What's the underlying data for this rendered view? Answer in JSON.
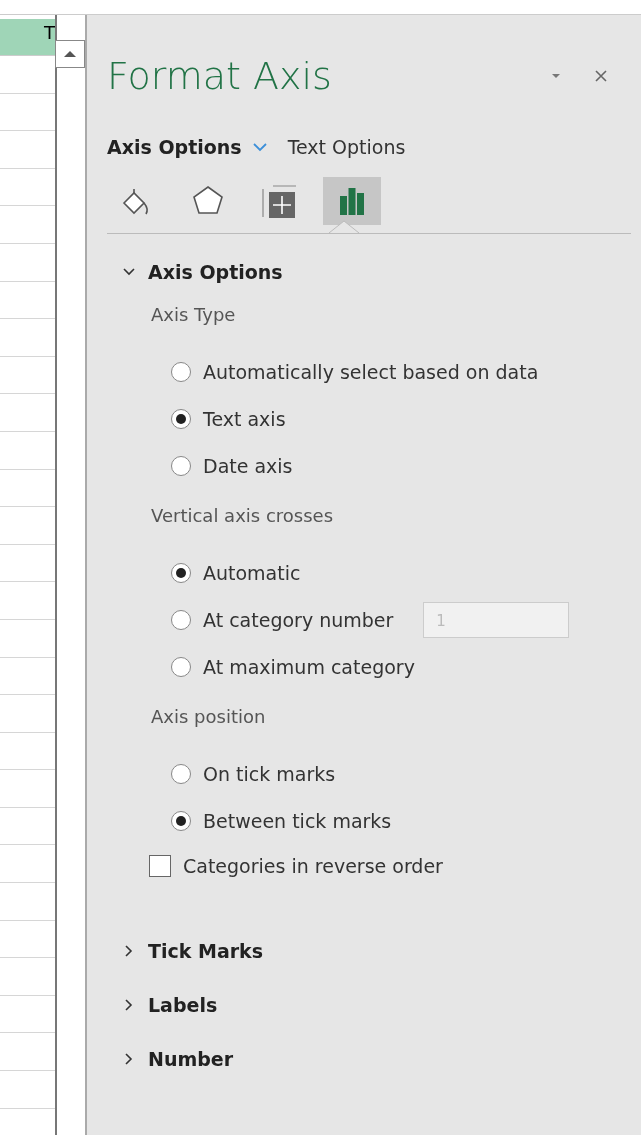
{
  "sheet": {
    "header_cell": "T"
  },
  "panel": {
    "title": "Format Axis",
    "tabs": [
      {
        "label": "Axis Options",
        "selected": true
      },
      {
        "label": "Text Options",
        "selected": false
      }
    ],
    "icon_tabs": [
      {
        "kind": "fill",
        "selected": false
      },
      {
        "kind": "effects",
        "selected": false
      },
      {
        "kind": "size",
        "selected": false
      },
      {
        "kind": "chart",
        "selected": true
      }
    ],
    "sections": [
      {
        "title": "Axis Options",
        "expanded": true,
        "groups": [
          {
            "heading": "Axis Type",
            "options": [
              {
                "kind": "radio",
                "label": "Automatically select based on data",
                "selected": false
              },
              {
                "kind": "radio",
                "label": "Text axis",
                "selected": true
              },
              {
                "kind": "radio",
                "label": "Date axis",
                "selected": false
              }
            ]
          },
          {
            "heading": "Vertical axis crosses",
            "options": [
              {
                "kind": "radio",
                "label": "Automatic",
                "selected": true
              },
              {
                "kind": "radio",
                "label": "At category number",
                "selected": false,
                "field": {
                  "value": "1",
                  "disabled": true
                }
              },
              {
                "kind": "radio",
                "label": "At maximum category",
                "selected": false
              }
            ]
          },
          {
            "heading": "Axis position",
            "options": [
              {
                "kind": "radio",
                "label": "On tick marks",
                "selected": false
              },
              {
                "kind": "radio",
                "label": "Between tick marks",
                "selected": true
              },
              {
                "kind": "checkbox",
                "label": "Categories in reverse order",
                "checked": false
              }
            ]
          }
        ]
      },
      {
        "title": "Tick Marks",
        "expanded": false
      },
      {
        "title": "Labels",
        "expanded": false
      },
      {
        "title": "Number",
        "expanded": false
      }
    ]
  }
}
